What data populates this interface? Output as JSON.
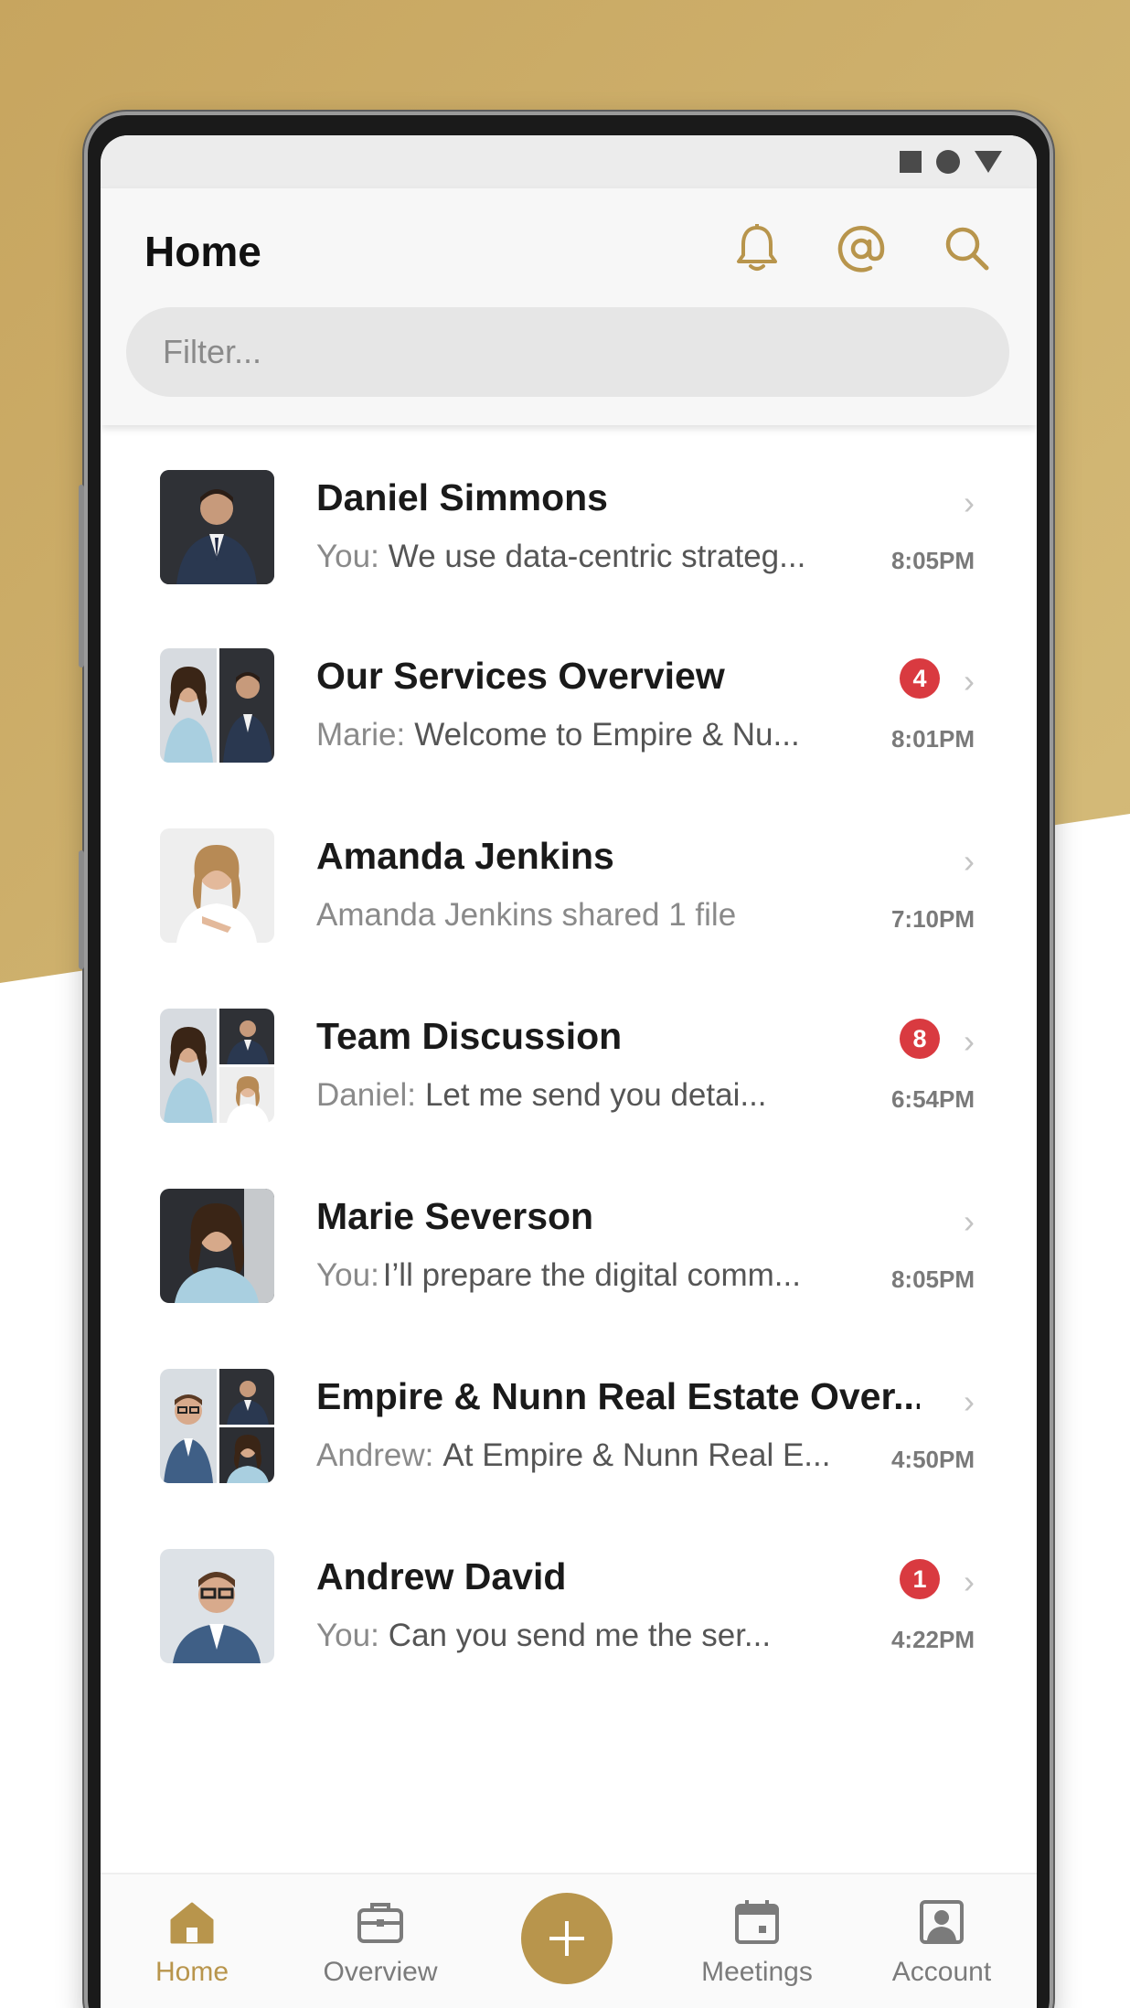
{
  "app": {
    "title": "Home",
    "accent_color": "#b8954c",
    "header_icons": [
      "bell-icon",
      "at-icon",
      "search-icon"
    ]
  },
  "filter": {
    "placeholder": "Filter..."
  },
  "conversations": [
    {
      "name": "Daniel Simmons",
      "sender": "You:",
      "message": "We use data-centric strateg...",
      "time": "8:05PM",
      "unread": null
    },
    {
      "name": "Our Services Overview",
      "sender": "Marie:",
      "message": "Welcome to Empire & Nu...",
      "time": "8:01PM",
      "unread": "4"
    },
    {
      "name": "Amanda Jenkins",
      "sender": "",
      "message": "Amanda Jenkins shared 1 file",
      "time": "7:10PM",
      "unread": null
    },
    {
      "name": "Team Discussion",
      "sender": "Daniel:",
      "message": "Let me send you detai...",
      "time": "6:54PM",
      "unread": "8"
    },
    {
      "name": "Marie Severson",
      "sender": "You:",
      "message": "I’ll prepare the digital comm...",
      "time": "8:05PM",
      "unread": null
    },
    {
      "name": "Empire & Nunn Real Estate Over...",
      "sender": "Andrew:",
      "message": "At Empire & Nunn Real E...",
      "time": "4:50PM",
      "unread": null
    },
    {
      "name": "Andrew David",
      "sender": "You:",
      "message": "Can you send me the ser...",
      "time": "4:22PM",
      "unread": "1"
    }
  ],
  "nav": {
    "home": "Home",
    "overview": "Overview",
    "meetings": "Meetings",
    "account": "Account"
  }
}
